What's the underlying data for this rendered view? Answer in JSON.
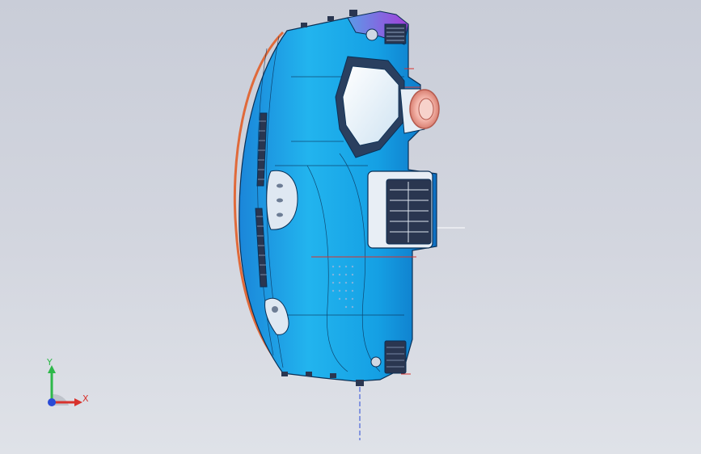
{
  "viewport": {
    "background_top": "#c9cdd8",
    "background_bottom": "#dfe2e8"
  },
  "model": {
    "part": "dashboard-instrument-panel",
    "body_color": "#1aa6e6",
    "edge_color": "#0a2f55",
    "inner_panel_color": "#eef3f8",
    "vent_color": "#2a3650",
    "accent_color": "#8a3fd6",
    "knob_color": "#f0a8a0",
    "trim_color": "#e06a3a"
  },
  "triad": {
    "y_label": "Y",
    "x_label": "X",
    "y_color": "#2db84a",
    "x_color": "#d8322d",
    "z_color": "#2a4bd6"
  }
}
